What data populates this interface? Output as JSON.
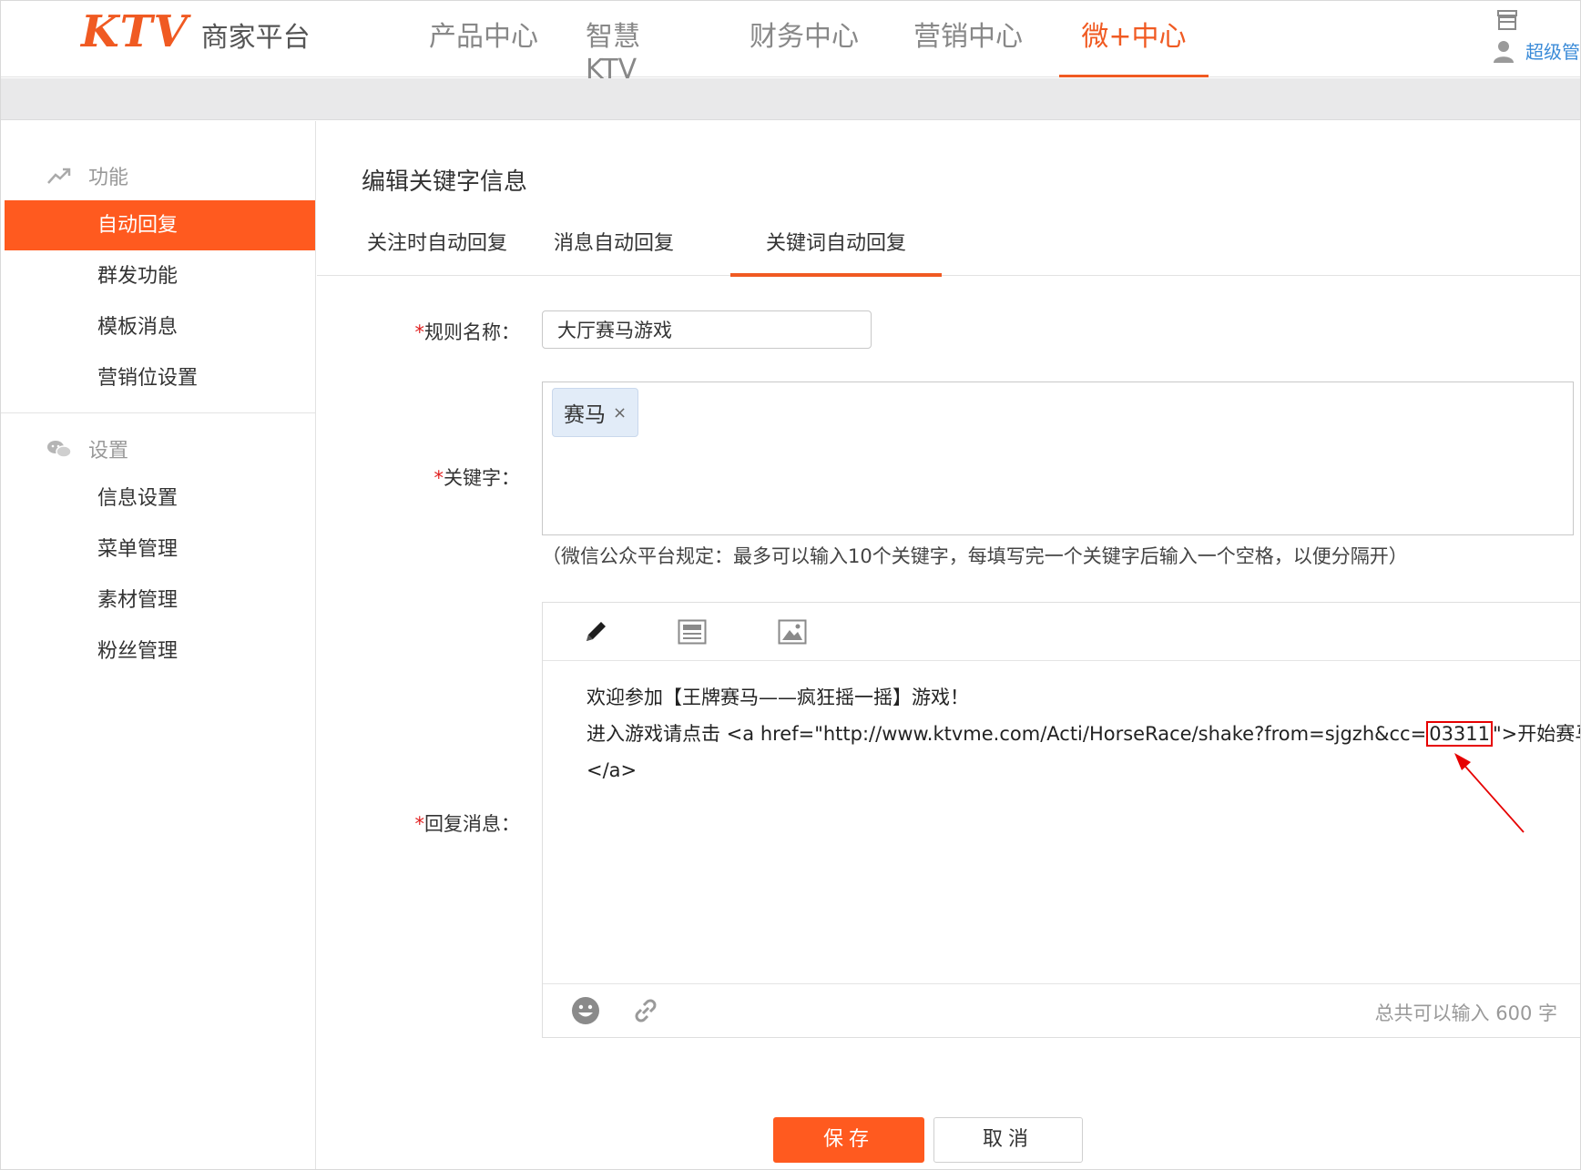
{
  "header": {
    "logo_brand": "KTV",
    "logo_text": "商家平台",
    "nav": [
      {
        "label": "产品中心"
      },
      {
        "label": "智慧KTV"
      },
      {
        "label": "财务中心"
      },
      {
        "label": "营销中心"
      },
      {
        "label": "微+中心",
        "active": true
      }
    ],
    "user_name": "超级管",
    "icons": [
      "store-icon",
      "user-icon"
    ]
  },
  "sidebar": {
    "groups": [
      {
        "title": "功能",
        "icon": "trend-chart-icon",
        "items": [
          {
            "label": "自动回复",
            "active": true
          },
          {
            "label": "群发功能"
          },
          {
            "label": "模板消息"
          },
          {
            "label": "营销位设置"
          }
        ]
      },
      {
        "title": "设置",
        "icon": "wechat-icon",
        "items": [
          {
            "label": "信息设置"
          },
          {
            "label": "菜单管理"
          },
          {
            "label": "素材管理"
          },
          {
            "label": "粉丝管理"
          }
        ]
      }
    ]
  },
  "main": {
    "title": "编辑关键字信息",
    "tabs": [
      {
        "label": "关注时自动回复"
      },
      {
        "label": "消息自动回复"
      },
      {
        "label": "关键词自动回复",
        "active": true
      }
    ]
  },
  "form": {
    "required_mark": "*",
    "rule_name_label": "规则名称：",
    "rule_name_value": "大厅赛马游戏",
    "keyword_label": "关键字：",
    "keywords": [
      "赛马"
    ],
    "keyword_remove": "×",
    "keyword_hint": "（微信公众平台规定：最多可以输入10个关键字，每填写完一个关键字后输入一个空格，以便分隔开）",
    "reply_label": "回复消息：",
    "reply_line1": "欢迎参加【王牌赛马——疯狂摇一摇】游戏！",
    "reply_line2_prefix": "进入游戏请点击 <a href=\"http://www.ktvme.com/Acti/HorseRace/shake?from=sjgzh&cc=",
    "reply_line2_highlight": "03311",
    "reply_line2_suffix": "\">开始赛马",
    "reply_line3": "</a>",
    "char_limit": "总共可以输入 600 字",
    "toolbar_icons": [
      "pencil-icon",
      "news-icon",
      "image-icon"
    ],
    "footer_icons": [
      "emoji-icon",
      "link-icon"
    ],
    "annotation_color": "#e60000"
  },
  "actions": {
    "save": "保存",
    "cancel": "取消"
  },
  "colors": {
    "accent": "#ff5a1f",
    "link": "#3b8bd8"
  }
}
